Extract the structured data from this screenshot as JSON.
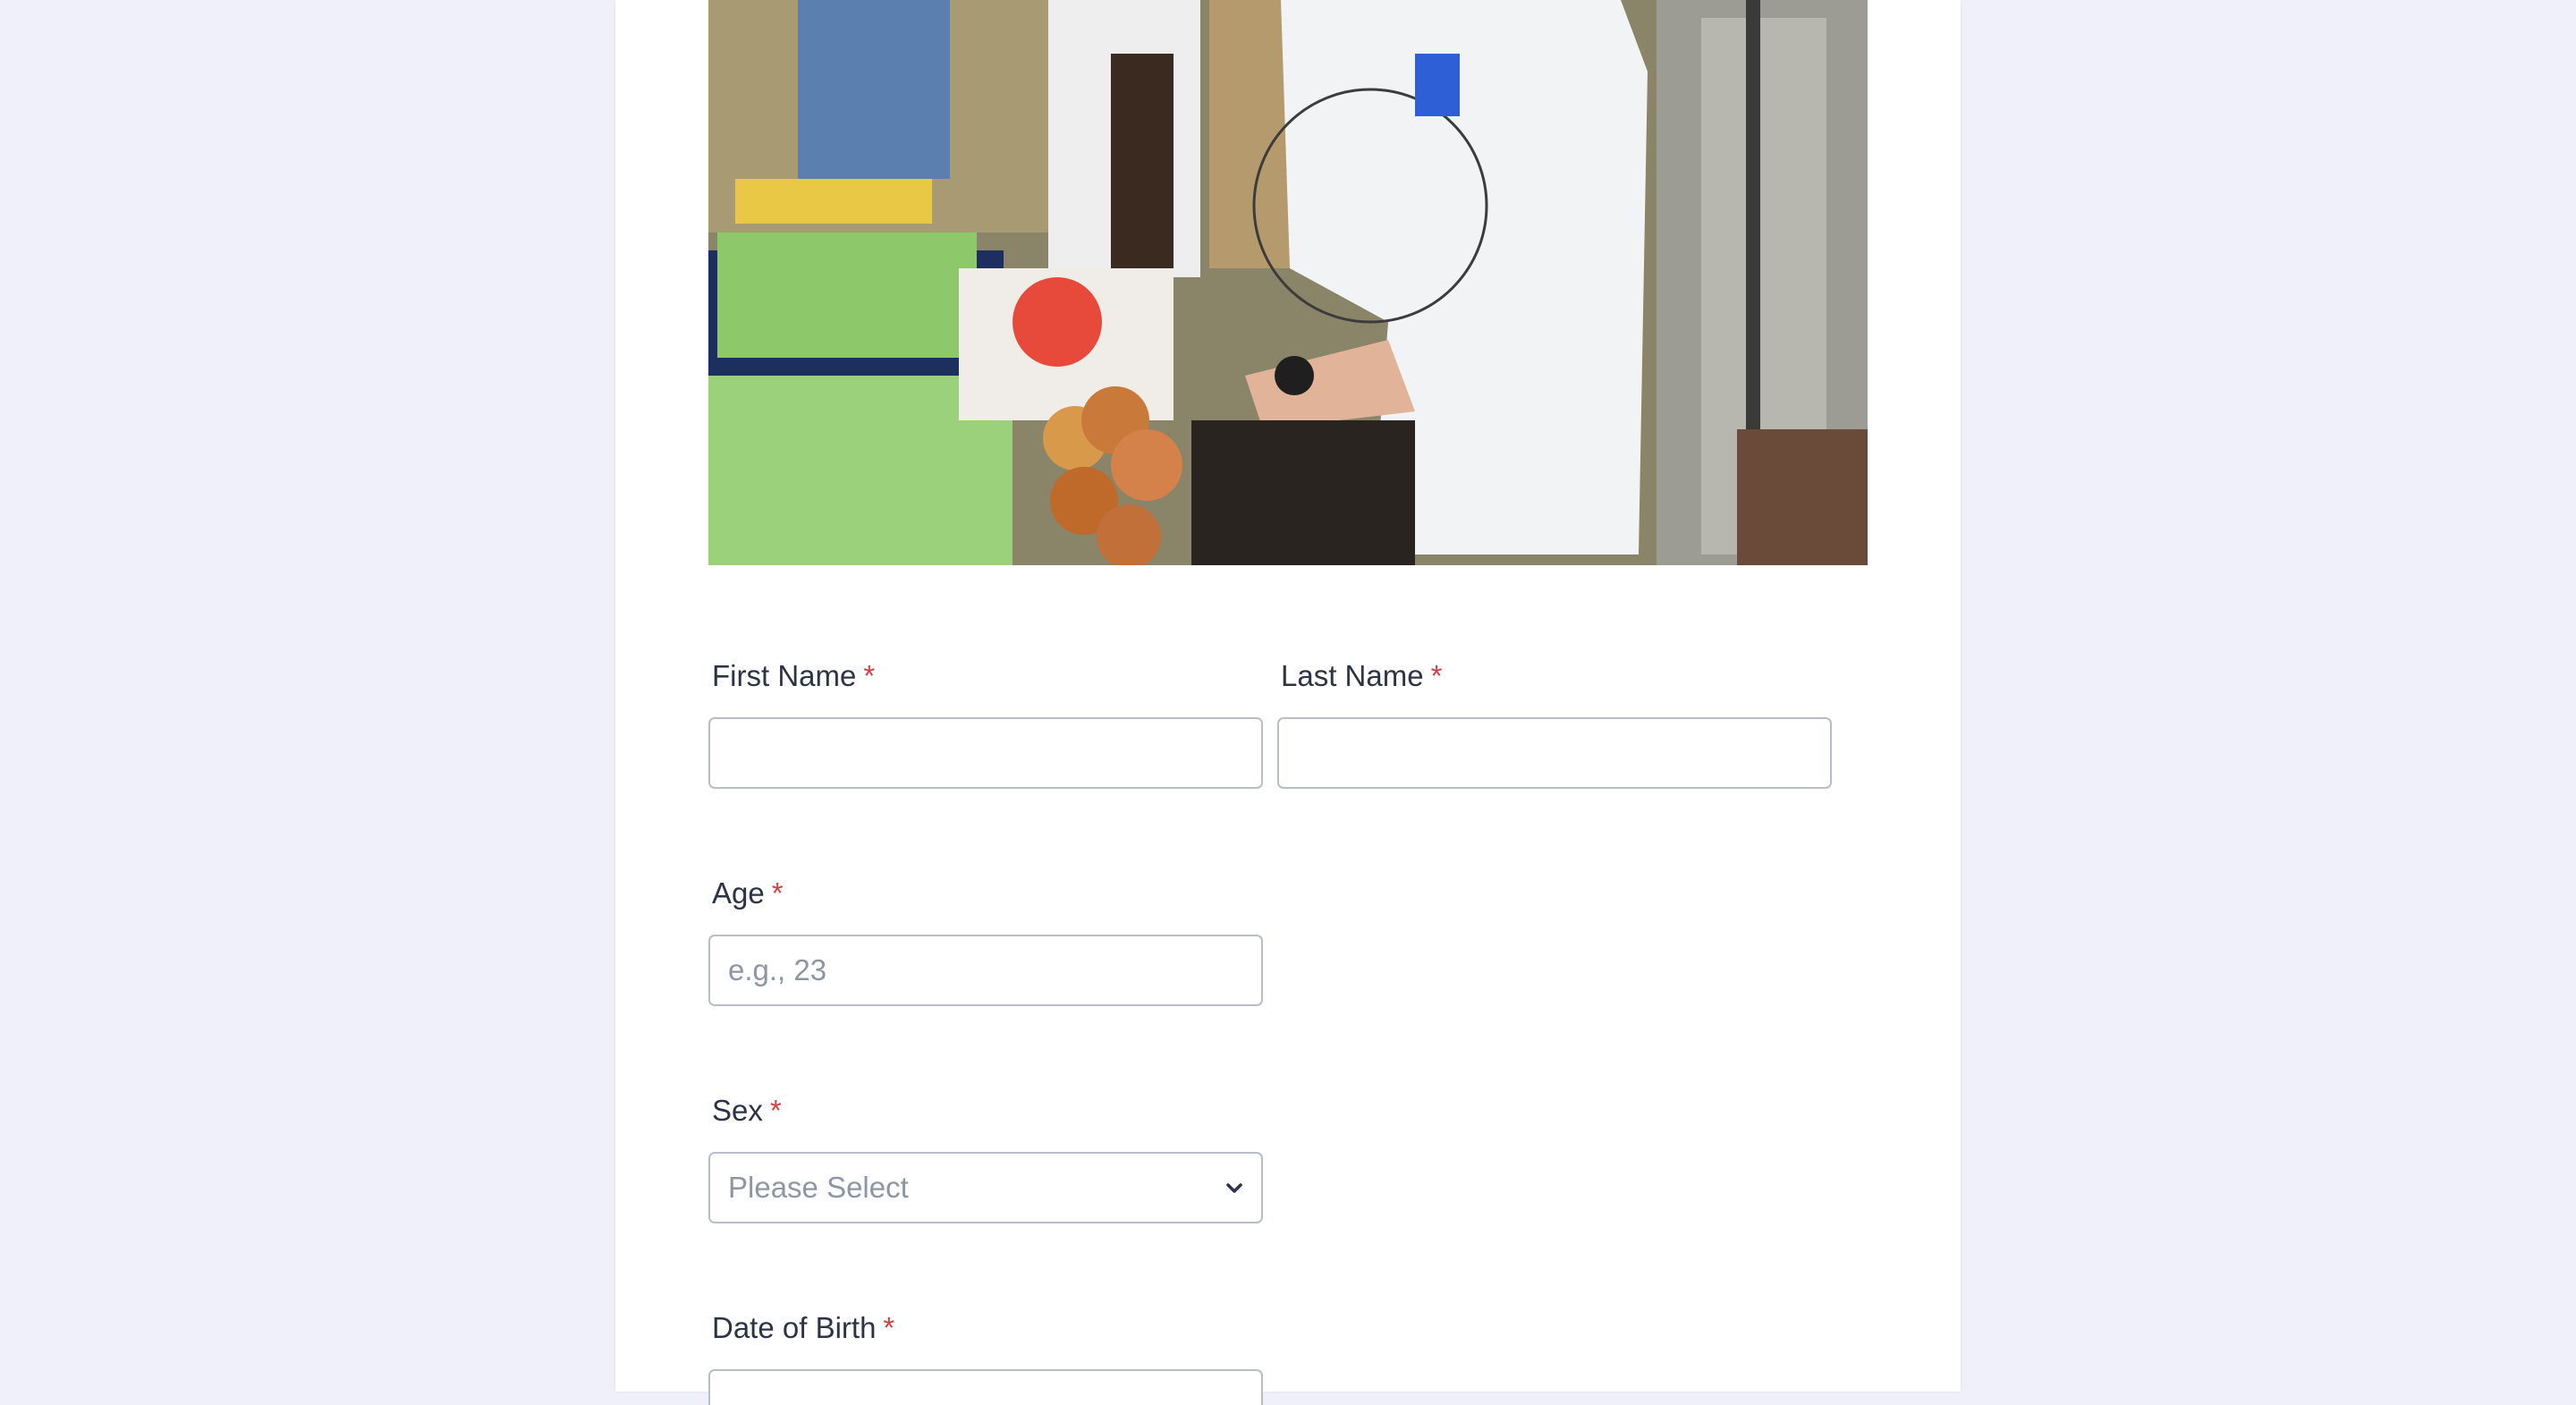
{
  "form": {
    "first_name": {
      "label": "First Name",
      "required_mark": "*",
      "value": "",
      "placeholder": ""
    },
    "last_name": {
      "label": "Last Name",
      "required_mark": "*",
      "value": "",
      "placeholder": ""
    },
    "age": {
      "label": "Age",
      "required_mark": "*",
      "value": "",
      "placeholder": "e.g., 23"
    },
    "sex": {
      "label": "Sex",
      "required_mark": "*",
      "selected": "Please Select"
    },
    "dob": {
      "label": "Date of Birth",
      "required_mark": "*"
    }
  },
  "icons": {
    "sex_dropdown": "chevron-down-icon"
  },
  "colors": {
    "page_background": "#eff0f9",
    "card_background": "#ffffff",
    "label_text": "#2c3345",
    "required_asterisk": "#d23f3f",
    "input_border": "#b8bdc9",
    "placeholder_text": "#8f96a3"
  }
}
